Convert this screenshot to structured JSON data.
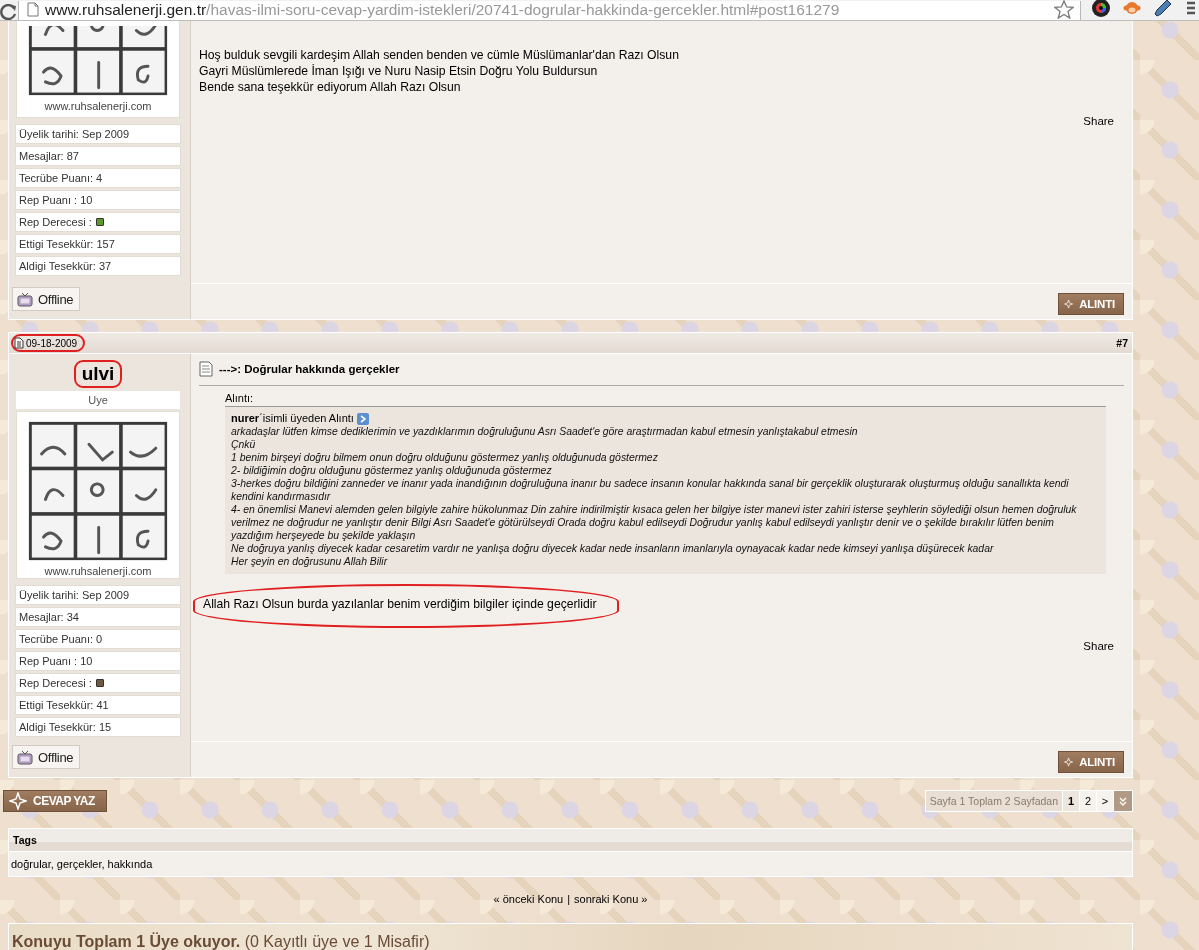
{
  "browser": {
    "url_host": "www.ruhsalenerji.gen.tr",
    "url_path": "/havas-ilmi-soru-cevap-yardim-istekleri/20741-dogrular-hakkinda-gercekler.html#post161279"
  },
  "posts": [
    {
      "cut_top": true,
      "avatar_caption": "www.ruhsalenerji.com",
      "stats": [
        {
          "text": "Üyelik tarihi: Sep 2009",
          "kind": "text"
        },
        {
          "text": "Mesajlar: 87",
          "kind": "text"
        },
        {
          "text": "Tecrübe Puanı: 4",
          "kind": "text"
        },
        {
          "text": "Rep Puanı : 10",
          "kind": "text"
        },
        {
          "text": "Rep Derecesi :",
          "kind": "rep",
          "color": "#5a9a28"
        },
        {
          "text": "Ettigi Tesekkür: 157",
          "kind": "text"
        },
        {
          "text": "Aldigi Tesekkür: 37",
          "kind": "text"
        }
      ],
      "status": "Offline",
      "body": [
        "Hoş bulduk sevgili kardeşim Allah senden benden ve cümle Müslümanlar'dan Razı Olsun",
        "Gayri Müslümlerede İman Işığı ve Nuru Nasip Etsin Doğru Yolu Buldursun",
        "Bende sana teşekkür ediyorum Allah Razı Olsun"
      ],
      "body_marked": false,
      "share": "Share",
      "quote_button": "ALINTI"
    },
    {
      "cut_top": false,
      "date": {
        "text": "09-18-2009",
        "marked": true
      },
      "number": "#7",
      "username": {
        "text": "ulvi",
        "marked": true
      },
      "rank": "Uye",
      "avatar_caption": "www.ruhsalenerji.com",
      "stats": [
        {
          "text": "Üyelik tarihi: Sep 2009",
          "kind": "text"
        },
        {
          "text": "Mesajlar: 34",
          "kind": "text"
        },
        {
          "text": "Tecrübe Puanı: 0",
          "kind": "text"
        },
        {
          "text": "Rep Puanı : 10",
          "kind": "text"
        },
        {
          "text": "Rep Derecesi :",
          "kind": "rep",
          "color": "#6e5a3e"
        },
        {
          "text": "Ettigi Tesekkür: 41",
          "kind": "text"
        },
        {
          "text": "Aldigi Tesekkür: 15",
          "kind": "text"
        }
      ],
      "status": "Offline",
      "title": "--->: Doğrular hakkında gerçekler",
      "quote": {
        "label": "Alıntı:",
        "header": "**nurer**´isimli üyeden Alıntı",
        "lines": [
          "arkadaşlar lütfen kimse dediklerimin ve yazdıklarımın doğruluğunu Asrı Saadet'e göre araştırmadan kabul etmesin yanlıştakabul etmesin",
          "Çnkü",
          "1 benim birşeyi doğru bilmem onun doğru olduğunu göstermez yanlış olduğunuda göstermez",
          "2- bildiğimin doğru olduğunu göstermez yanlış olduğunuda göstermez",
          "3-herkes doğru bildiğini zanneder ve inanır yada inandığının doğruluğuna inanır bu sadece insanın konular hakkında sanal bir gerçeklik oluşturarak oluşturmuş olduğu sanallıkta kendi",
          "kendini kandırmasıdır",
          "4- en önemlisi Manevi alemden gelen bilgiyle zahire hükolunmaz Din zahire indirilmiştir kısaca gelen her bilgiye ister manevi ister zahiri isterse şeyhlerin söylediği olsun hemen doğruluk",
          "verilmez ne doğrudur ne yanlıştır denir Bilgi Asrı Saadet'e götürülseydi Orada doğru kabul edilseydi Doğrudur yanlış kabul edilseydi yanlıştır denir ve o şekilde bırakılır lütfen benim",
          "yazdığım herşeyede bu şekilde yaklaşın",
          "Ne doğruya yanlış diyecek kadar cesaretim vardır ne yanlışa doğru diyecek kadar nede insanların imanlarıyla oynayacak kadar nede kimseyi yanlışa düşürecek kadar",
          "Her şeyin en doğrusunu Allah Bilir"
        ]
      },
      "body": [
        "Allah Razı Olsun burda yazılanlar benim verdiğim bilgiler içinde geçerlidir"
      ],
      "body_marked": true,
      "share": "Share",
      "quote_button": "ALINTI"
    }
  ],
  "reply_button": "CEVAP YAZ",
  "pagination": {
    "label": "Sayfa 1 Toplam 2 Sayfadan",
    "pages": [
      {
        "label": "1",
        "selected": true
      },
      {
        "label": "2",
        "selected": false
      },
      {
        "label": ">",
        "selected": false
      }
    ]
  },
  "tags": {
    "title": "Tags",
    "text": "doğrular, gerçekler, hakkında"
  },
  "thread_nav": {
    "prev": "« önceki Konu",
    "separator": "|",
    "next": "sonraki Konu »"
  },
  "viewers": "**Konuyu Toplam 1 Üye okuyor.** (0 Kayıtlı üye ve 1 Misafir)"
}
